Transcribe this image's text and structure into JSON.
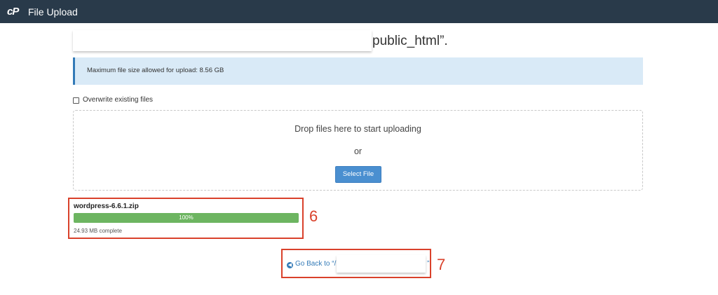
{
  "header": {
    "logo_text": "cP",
    "title": "File Upload"
  },
  "destination": {
    "path_suffix": "public_html”."
  },
  "alert": {
    "text": "Maximum file size allowed for upload: 8.56 GB"
  },
  "options": {
    "overwrite_label": "Overwrite existing files",
    "overwrite_checked": false
  },
  "dropzone": {
    "instruction": "Drop files here to start uploading",
    "or_text": "or",
    "select_button_label": "Select File"
  },
  "upload": {
    "file_name": "wordpress-6.6.1.zip",
    "progress_percent": 100,
    "progress_label": "100%",
    "status_text": "24.93 MB complete"
  },
  "navigation": {
    "go_back_label": "Go Back to “/",
    "go_back_suffix": "”"
  },
  "annotations": {
    "step_six": "6",
    "step_seven": "7"
  },
  "colors": {
    "header_bg": "#293a4a",
    "alert_bg": "#d9eaf7",
    "primary": "#337ab7",
    "button_bg": "#4a8fd0",
    "progress_fill": "#6db561",
    "annotation_red": "#d9412b"
  },
  "icons": {
    "logo": "cpanel-logo-icon",
    "checkbox": "checkbox-icon",
    "go_back": "circle-arrow-left-icon"
  }
}
